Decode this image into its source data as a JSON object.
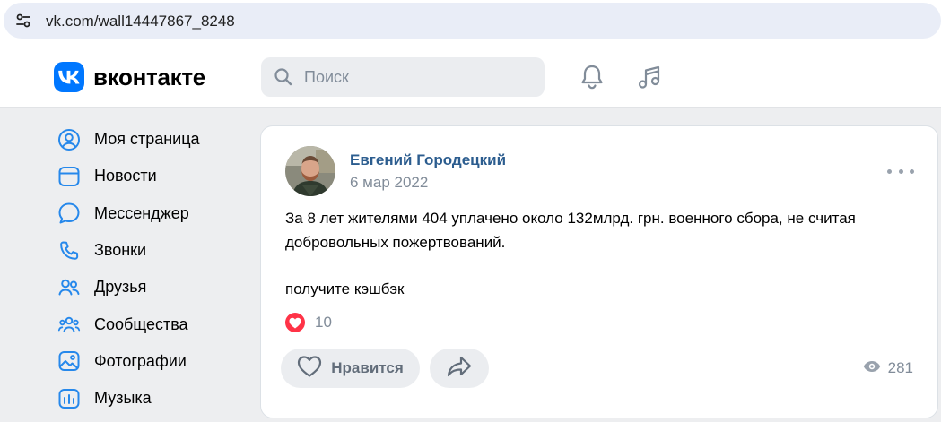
{
  "browser": {
    "url": "vk.com/wall14447867_8248"
  },
  "header": {
    "logo_text": "вконтакте",
    "search_placeholder": "Поиск"
  },
  "sidebar": {
    "items": [
      {
        "label": "Моя страница",
        "icon": "user-circle-icon"
      },
      {
        "label": "Новости",
        "icon": "news-icon"
      },
      {
        "label": "Мессенджер",
        "icon": "message-icon"
      },
      {
        "label": "Звонки",
        "icon": "phone-icon"
      },
      {
        "label": "Друзья",
        "icon": "friends-icon"
      },
      {
        "label": "Сообщества",
        "icon": "communities-icon"
      },
      {
        "label": "Фотографии",
        "icon": "photo-icon"
      },
      {
        "label": "Музыка",
        "icon": "music-chart-icon"
      }
    ]
  },
  "post": {
    "author": "Евгений Городецкий",
    "date": "6 мар 2022",
    "text_line1": "За 8 лет жителями 404 уплачено около 132млрд. грн. военного сбора, не считая",
    "text_line2": "добровольных пожертвований.",
    "text_line3": "получите кэшбэк",
    "reaction_count": "10",
    "like_label": "Нравится",
    "views": "281"
  },
  "colors": {
    "accent": "#0077ff",
    "author_link": "#2c5d8f",
    "like_red": "#ff3347",
    "background": "#edeef0"
  }
}
